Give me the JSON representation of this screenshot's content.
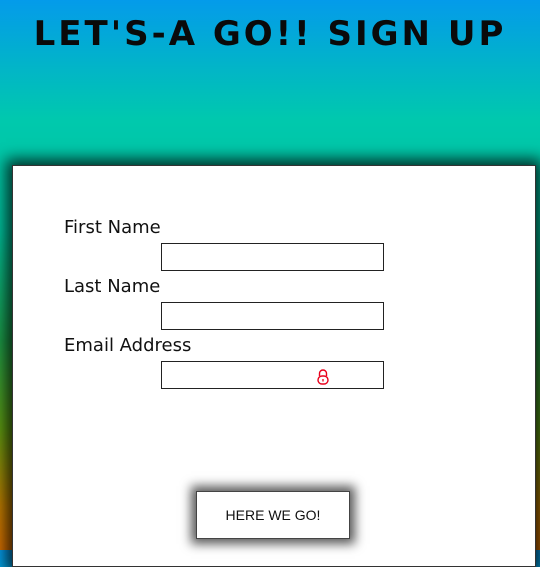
{
  "header": {
    "title": "LET'S-A GO!! SIGN UP"
  },
  "form": {
    "first_name_label": "First Name",
    "first_name_value": "",
    "last_name_label": "Last Name",
    "last_name_value": "",
    "email_label": "Email Address",
    "email_value": "",
    "email_icon": "lock-icon",
    "submit_label": "HERE WE GO!"
  },
  "colors": {
    "gradient_top": "#049bea",
    "gradient_mid": "#00c9ad",
    "gradient_bottom": "#d66f00",
    "card_background": "#ffffff",
    "lock_icon": "#e8001c"
  }
}
